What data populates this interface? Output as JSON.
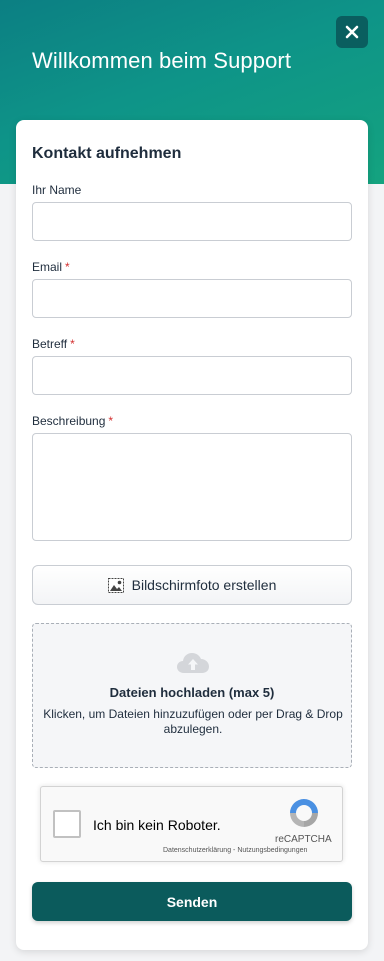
{
  "header": {
    "title": "Willkommen beim Support",
    "close_icon": "close-icon"
  },
  "form": {
    "title": "Kontakt aufnehmen",
    "required_marker": "*",
    "name": {
      "label": "Ihr Name",
      "value": ""
    },
    "email": {
      "label": "Email",
      "value": ""
    },
    "subject": {
      "label": "Betreff",
      "value": ""
    },
    "description": {
      "label": "Beschreibung",
      "value": ""
    },
    "screenshot_button": {
      "label": "Bildschirmfoto erstellen",
      "icon": "image-icon"
    },
    "upload": {
      "title": "Dateien hochladen (max 5)",
      "subtitle": "Klicken, um Dateien hinzuzufügen oder per Drag & Drop abzulegen.",
      "icon": "cloud-upload-icon"
    },
    "captcha": {
      "label": "Ich bin kein Roboter.",
      "brand": "reCAPTCHA",
      "links": "Datenschutzerklärung - Nutzungsbedingungen"
    },
    "submit_label": "Senden"
  },
  "colors": {
    "accent": "#0e9488",
    "button": "#0b5b5c",
    "required": "#d32f2f"
  }
}
